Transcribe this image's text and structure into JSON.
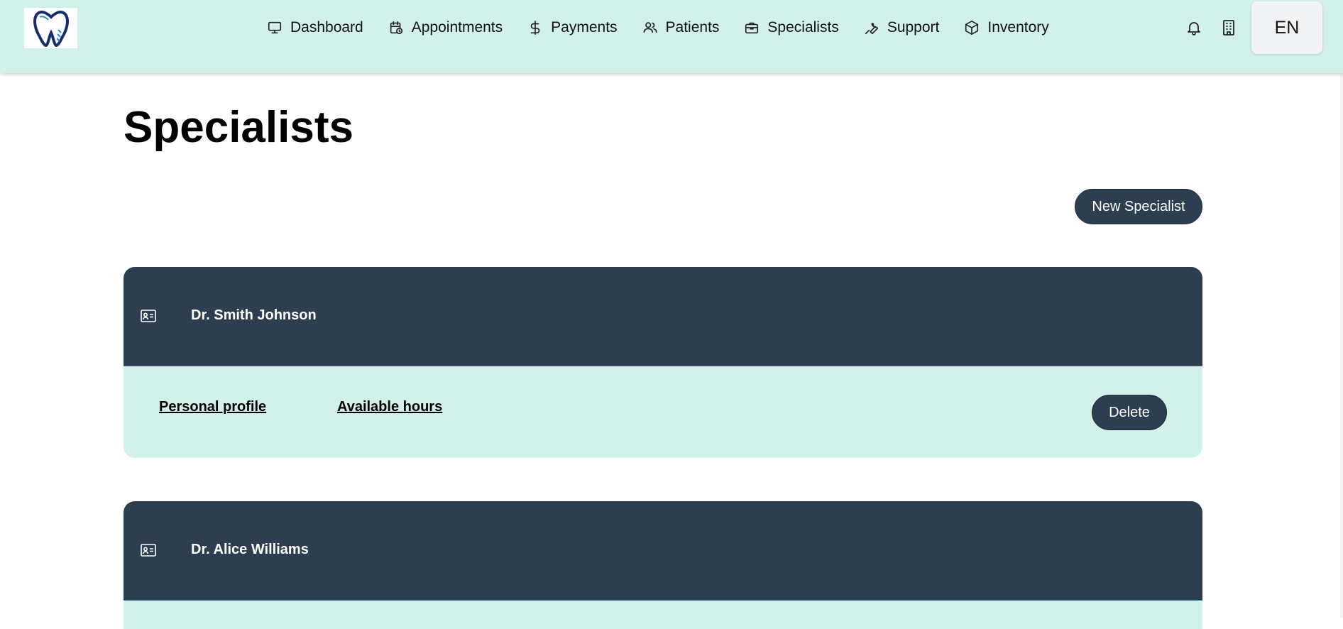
{
  "header": {
    "logo_icon": "tooth-logo-icon",
    "nav": [
      {
        "label": "Dashboard",
        "icon": "monitor-icon"
      },
      {
        "label": "Appointments",
        "icon": "calendar-clock-icon"
      },
      {
        "label": "Payments",
        "icon": "dollar-icon"
      },
      {
        "label": "Patients",
        "icon": "users-icon"
      },
      {
        "label": "Specialists",
        "icon": "briefcase-icon"
      },
      {
        "label": "Support",
        "icon": "wrench-icon"
      },
      {
        "label": "Inventory",
        "icon": "box-icon"
      }
    ],
    "notifications_icon": "bell-icon",
    "clinic_icon": "building-icon",
    "language": "EN"
  },
  "page": {
    "title": "Specialists",
    "new_button": "New Specialist"
  },
  "specialists": [
    {
      "name": "Dr. Smith Johnson",
      "icon": "id-card-icon",
      "links": [
        "Personal profile",
        "Available hours"
      ],
      "delete_label": "Delete"
    },
    {
      "name": "Dr. Alice Williams",
      "icon": "id-card-icon"
    }
  ],
  "colors": {
    "header_bg": "#d2f1ea",
    "card_header_bg": "#2d3e51",
    "card_body_bg": "#d2f1ea",
    "button_bg": "#2d3e51"
  }
}
